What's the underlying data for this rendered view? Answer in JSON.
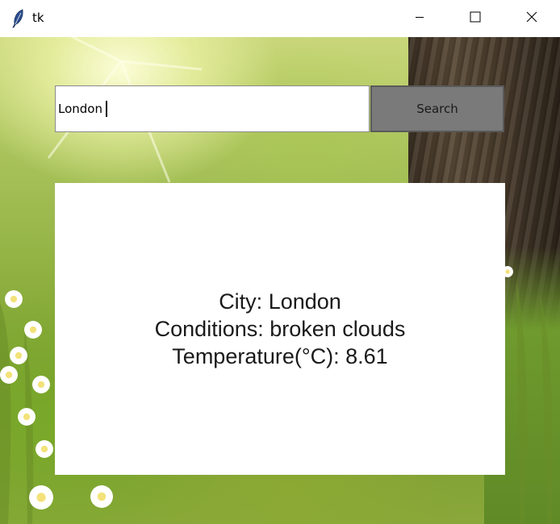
{
  "window": {
    "title": "tk",
    "icons": {
      "app": "feather-icon",
      "minimize": "minimize-icon",
      "maximize": "maximize-icon",
      "close": "close-icon"
    }
  },
  "search": {
    "value": "London",
    "button_label": "Search"
  },
  "result": {
    "city": "City: London",
    "conditions": "Conditions: broken clouds",
    "temperature": "Temperature(°C): 8.61"
  },
  "colors": {
    "button_bg": "#7a7a7a",
    "panel_bg": "#ffffff"
  }
}
